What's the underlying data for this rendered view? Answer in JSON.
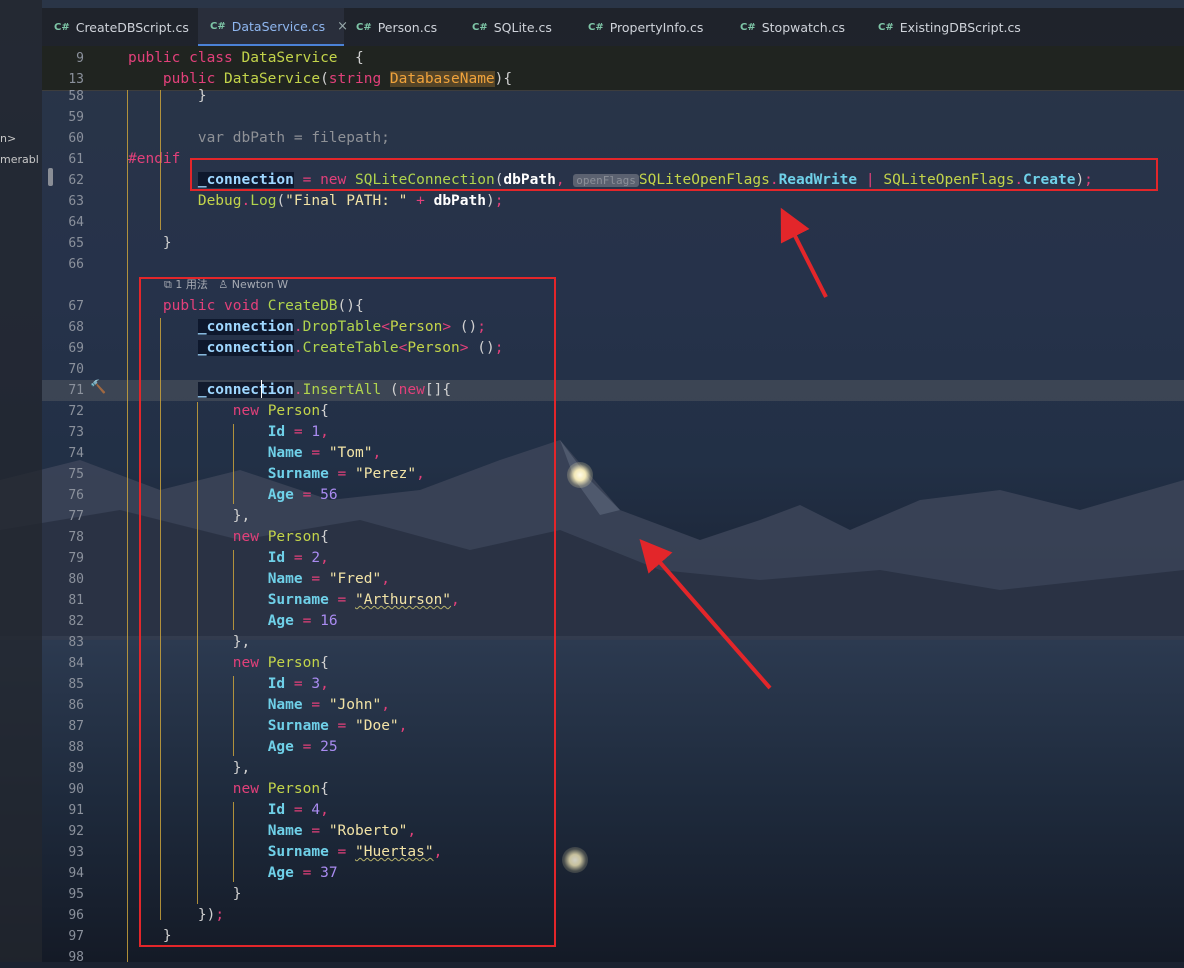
{
  "left_panel": {
    "lines": [
      "n>",
      "merabl"
    ]
  },
  "tabs": [
    {
      "icon": "C#",
      "label": "CreateDBScript.cs",
      "active": false
    },
    {
      "icon": "C#",
      "label": "DataService.cs",
      "active": true,
      "close": "×"
    },
    {
      "icon": "C#",
      "label": "Person.cs",
      "active": false
    },
    {
      "icon": "C#",
      "label": "SQLite.cs",
      "active": false
    },
    {
      "icon": "C#",
      "label": "PropertyInfo.cs",
      "active": false
    },
    {
      "icon": "C#",
      "label": "Stopwatch.cs",
      "active": false
    },
    {
      "icon": "C#",
      "label": "ExistingDBScript.cs",
      "active": false
    }
  ],
  "codelens": {
    "usages": "1 用法",
    "author": "Newton W"
  },
  "inlay_hint": "openFlags",
  "lines": [
    {
      "n": "9",
      "tokens": [
        [
          "kw",
          "public "
        ],
        [
          "kw",
          "class "
        ],
        [
          "ty",
          "DataService"
        ],
        [
          "pn",
          "  {"
        ]
      ]
    },
    {
      "n": "13",
      "tokens": [
        [
          "pn",
          "    "
        ],
        [
          "kw",
          "public "
        ],
        [
          "ty",
          "DataService"
        ],
        [
          "pn",
          "("
        ],
        [
          "kw",
          "string "
        ],
        [
          "prm",
          "DatabaseName"
        ],
        [
          "pn",
          "){"
        ]
      ]
    },
    {
      "n": "58",
      "tokens": [
        [
          "pn",
          "        }"
        ]
      ]
    },
    {
      "n": "59",
      "tokens": []
    },
    {
      "n": "60",
      "tokens": [
        [
          "gray",
          "        var dbPath = filepath;"
        ]
      ]
    },
    {
      "n": "61",
      "tokens": [
        [
          "dir",
          "#endif"
        ]
      ]
    },
    {
      "n": "62",
      "tokens": [
        [
          "pn",
          "        "
        ],
        [
          "fld",
          "_connection"
        ],
        [
          "op",
          " = "
        ],
        [
          "kw",
          "new "
        ],
        [
          "fn",
          "SQLiteConnection"
        ],
        [
          "pn",
          "("
        ],
        [
          "id",
          "dbPath"
        ],
        [
          "op",
          ", "
        ],
        [
          "hint",
          "openFlags"
        ],
        [
          "ty",
          "SQLiteOpenFlags"
        ],
        [
          "op",
          "."
        ],
        [
          "pr",
          "ReadWrite"
        ],
        [
          "op",
          " | "
        ],
        [
          "ty",
          "SQLiteOpenFlags"
        ],
        [
          "op",
          "."
        ],
        [
          "pr",
          "Create"
        ],
        [
          "pn",
          ")"
        ],
        [
          "op",
          ";"
        ]
      ]
    },
    {
      "n": "63",
      "tokens": [
        [
          "pn",
          "        "
        ],
        [
          "ty",
          "Debug"
        ],
        [
          "op",
          "."
        ],
        [
          "fn",
          "Log"
        ],
        [
          "pn",
          "("
        ],
        [
          "str",
          "\"Final PATH: \""
        ],
        [
          "op",
          " + "
        ],
        [
          "id",
          "dbPath"
        ],
        [
          "pn",
          ")"
        ],
        [
          "op",
          ";"
        ]
      ]
    },
    {
      "n": "64",
      "tokens": []
    },
    {
      "n": "65",
      "tokens": [
        [
          "pn",
          "    }"
        ]
      ]
    },
    {
      "n": "66",
      "tokens": []
    },
    {
      "n": "67",
      "tokens": [
        [
          "pn",
          "    "
        ],
        [
          "kw",
          "public "
        ],
        [
          "kw",
          "void "
        ],
        [
          "fn",
          "CreateDB"
        ],
        [
          "pn",
          "(){"
        ]
      ]
    },
    {
      "n": "68",
      "tokens": [
        [
          "pn",
          "        "
        ],
        [
          "fld",
          "_connection"
        ],
        [
          "op",
          "."
        ],
        [
          "fn",
          "DropTable"
        ],
        [
          "op",
          "<"
        ],
        [
          "ty",
          "Person"
        ],
        [
          "op",
          "> "
        ],
        [
          "pn",
          "()"
        ],
        [
          "op",
          ";"
        ]
      ]
    },
    {
      "n": "69",
      "tokens": [
        [
          "pn",
          "        "
        ],
        [
          "fld",
          "_connection"
        ],
        [
          "op",
          "."
        ],
        [
          "fn",
          "CreateTable"
        ],
        [
          "op",
          "<"
        ],
        [
          "ty",
          "Person"
        ],
        [
          "op",
          "> "
        ],
        [
          "pn",
          "()"
        ],
        [
          "op",
          ";"
        ]
      ]
    },
    {
      "n": "70",
      "tokens": []
    },
    {
      "n": "71",
      "tokens": [
        [
          "pn",
          "        "
        ],
        [
          "fld",
          "_connection"
        ],
        [
          "op",
          "."
        ],
        [
          "fn",
          "InsertAll "
        ],
        [
          "pn",
          "("
        ],
        [
          "kw",
          "new"
        ],
        [
          "pn",
          "[]{"
        ]
      ]
    },
    {
      "n": "72",
      "tokens": [
        [
          "pn",
          "            "
        ],
        [
          "kw",
          "new "
        ],
        [
          "ty",
          "Person"
        ],
        [
          "pn",
          "{"
        ]
      ]
    },
    {
      "n": "73",
      "tokens": [
        [
          "pn",
          "                "
        ],
        [
          "pr",
          "Id"
        ],
        [
          "op",
          " = "
        ],
        [
          "num",
          "1"
        ],
        [
          "op",
          ","
        ]
      ]
    },
    {
      "n": "74",
      "tokens": [
        [
          "pn",
          "                "
        ],
        [
          "pr",
          "Name"
        ],
        [
          "op",
          " = "
        ],
        [
          "str",
          "\"Tom\""
        ],
        [
          "op",
          ","
        ]
      ]
    },
    {
      "n": "75",
      "tokens": [
        [
          "pn",
          "                "
        ],
        [
          "pr",
          "Surname"
        ],
        [
          "op",
          " = "
        ],
        [
          "str",
          "\"Perez\""
        ],
        [
          "op",
          ","
        ]
      ]
    },
    {
      "n": "76",
      "tokens": [
        [
          "pn",
          "                "
        ],
        [
          "pr",
          "Age"
        ],
        [
          "op",
          " = "
        ],
        [
          "num",
          "56"
        ]
      ]
    },
    {
      "n": "77",
      "tokens": [
        [
          "pn",
          "            },"
        ]
      ]
    },
    {
      "n": "78",
      "tokens": [
        [
          "pn",
          "            "
        ],
        [
          "kw",
          "new "
        ],
        [
          "ty",
          "Person"
        ],
        [
          "pn",
          "{"
        ]
      ]
    },
    {
      "n": "79",
      "tokens": [
        [
          "pn",
          "                "
        ],
        [
          "pr",
          "Id"
        ],
        [
          "op",
          " = "
        ],
        [
          "num",
          "2"
        ],
        [
          "op",
          ","
        ]
      ]
    },
    {
      "n": "80",
      "tokens": [
        [
          "pn",
          "                "
        ],
        [
          "pr",
          "Name"
        ],
        [
          "op",
          " = "
        ],
        [
          "str",
          "\"Fred\""
        ],
        [
          "op",
          ","
        ]
      ]
    },
    {
      "n": "81",
      "tokens": [
        [
          "pn",
          "                "
        ],
        [
          "pr",
          "Surname"
        ],
        [
          "op",
          " = "
        ],
        [
          "str",
          "\"Arthurson\""
        ],
        [
          "op",
          ","
        ]
      ]
    },
    {
      "n": "82",
      "tokens": [
        [
          "pn",
          "                "
        ],
        [
          "pr",
          "Age"
        ],
        [
          "op",
          " = "
        ],
        [
          "num",
          "16"
        ]
      ]
    },
    {
      "n": "83",
      "tokens": [
        [
          "pn",
          "            },"
        ]
      ]
    },
    {
      "n": "84",
      "tokens": [
        [
          "pn",
          "            "
        ],
        [
          "kw",
          "new "
        ],
        [
          "ty",
          "Person"
        ],
        [
          "pn",
          "{"
        ]
      ]
    },
    {
      "n": "85",
      "tokens": [
        [
          "pn",
          "                "
        ],
        [
          "pr",
          "Id"
        ],
        [
          "op",
          " = "
        ],
        [
          "num",
          "3"
        ],
        [
          "op",
          ","
        ]
      ]
    },
    {
      "n": "86",
      "tokens": [
        [
          "pn",
          "                "
        ],
        [
          "pr",
          "Name"
        ],
        [
          "op",
          " = "
        ],
        [
          "str",
          "\"John\""
        ],
        [
          "op",
          ","
        ]
      ]
    },
    {
      "n": "87",
      "tokens": [
        [
          "pn",
          "                "
        ],
        [
          "pr",
          "Surname"
        ],
        [
          "op",
          " = "
        ],
        [
          "str",
          "\"Doe\""
        ],
        [
          "op",
          ","
        ]
      ]
    },
    {
      "n": "88",
      "tokens": [
        [
          "pn",
          "                "
        ],
        [
          "pr",
          "Age"
        ],
        [
          "op",
          " = "
        ],
        [
          "num",
          "25"
        ]
      ]
    },
    {
      "n": "89",
      "tokens": [
        [
          "pn",
          "            },"
        ]
      ]
    },
    {
      "n": "90",
      "tokens": [
        [
          "pn",
          "            "
        ],
        [
          "kw",
          "new "
        ],
        [
          "ty",
          "Person"
        ],
        [
          "pn",
          "{"
        ]
      ]
    },
    {
      "n": "91",
      "tokens": [
        [
          "pn",
          "                "
        ],
        [
          "pr",
          "Id"
        ],
        [
          "op",
          " = "
        ],
        [
          "num",
          "4"
        ],
        [
          "op",
          ","
        ]
      ]
    },
    {
      "n": "92",
      "tokens": [
        [
          "pn",
          "                "
        ],
        [
          "pr",
          "Name"
        ],
        [
          "op",
          " = "
        ],
        [
          "str",
          "\"Roberto\""
        ],
        [
          "op",
          ","
        ]
      ]
    },
    {
      "n": "93",
      "tokens": [
        [
          "pn",
          "                "
        ],
        [
          "pr",
          "Surname"
        ],
        [
          "op",
          " = "
        ],
        [
          "str",
          "\"Huertas\""
        ],
        [
          "op",
          ","
        ]
      ]
    },
    {
      "n": "94",
      "tokens": [
        [
          "pn",
          "                "
        ],
        [
          "pr",
          "Age"
        ],
        [
          "op",
          " = "
        ],
        [
          "num",
          "37"
        ]
      ]
    },
    {
      "n": "95",
      "tokens": [
        [
          "pn",
          "            }"
        ]
      ]
    },
    {
      "n": "96",
      "tokens": [
        [
          "pn",
          "        })"
        ],
        [
          "op",
          ";"
        ]
      ]
    },
    {
      "n": "97",
      "tokens": [
        [
          "pn",
          "    }"
        ]
      ]
    },
    {
      "n": "98",
      "tokens": []
    }
  ],
  "highlighted_line": "71",
  "colors": {
    "accent": "#4b82d6",
    "annotation_red": "#e3262a",
    "keyword": "#e2407a"
  }
}
